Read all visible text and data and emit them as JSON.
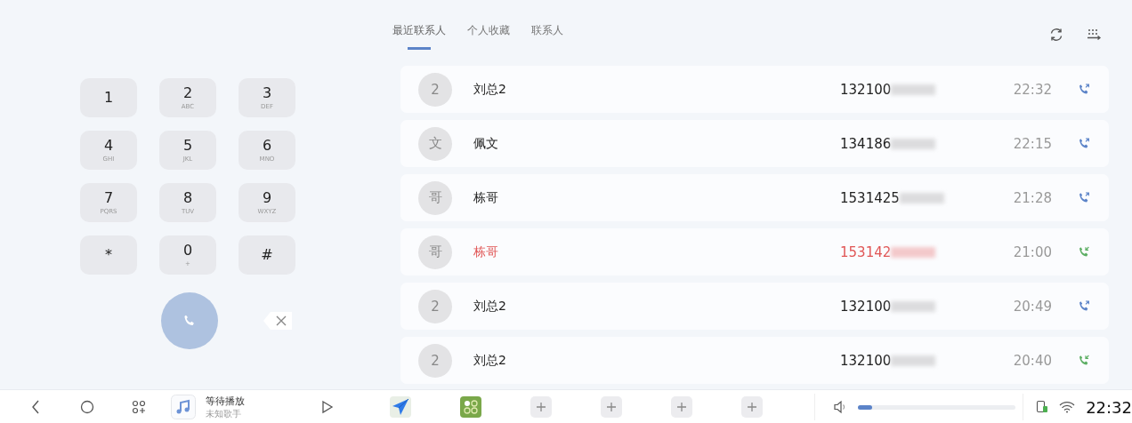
{
  "dialpad": {
    "keys": [
      {
        "digit": "1"
      },
      {
        "digit": "2",
        "letters": "ABC"
      },
      {
        "digit": "3",
        "letters": "DEF"
      },
      {
        "digit": "4",
        "letters": "GHI"
      },
      {
        "digit": "5",
        "letters": "JKL"
      },
      {
        "digit": "6",
        "letters": "MNO"
      },
      {
        "digit": "7",
        "letters": "PQRS"
      },
      {
        "digit": "8",
        "letters": "TUV"
      },
      {
        "digit": "9",
        "letters": "WXYZ"
      },
      {
        "digit": "*"
      },
      {
        "digit": "0",
        "letters": "+"
      },
      {
        "digit": "#"
      }
    ]
  },
  "tabs": [
    {
      "label": "最近联系人",
      "selected": true
    },
    {
      "label": "个人收藏",
      "selected": false
    },
    {
      "label": "联系人",
      "selected": false
    }
  ],
  "calls": [
    {
      "avatar": "2",
      "name": "刘总2",
      "number": "132100",
      "time": "22:32",
      "kind": "outgoing",
      "missed": false
    },
    {
      "avatar": "文",
      "name": "佩文",
      "number": "134186",
      "time": "22:15",
      "kind": "outgoing",
      "missed": false
    },
    {
      "avatar": "哥",
      "name": "栋哥",
      "number": "1531425",
      "time": "21:28",
      "kind": "outgoing",
      "missed": false
    },
    {
      "avatar": "哥",
      "name": "栋哥",
      "number": "153142",
      "time": "21:00",
      "kind": "incoming",
      "missed": true
    },
    {
      "avatar": "2",
      "name": "刘总2",
      "number": "132100",
      "time": "20:49",
      "kind": "outgoing",
      "missed": false
    },
    {
      "avatar": "2",
      "name": "刘总2",
      "number": "132100",
      "time": "20:40",
      "kind": "incoming",
      "missed": false
    }
  ],
  "taskbar": {
    "media": {
      "title": "等待播放",
      "artist": "未知歌手"
    },
    "dock": [
      {
        "kind": "navigation"
      },
      {
        "kind": "apps"
      },
      {
        "kind": "add"
      },
      {
        "kind": "add"
      },
      {
        "kind": "add"
      },
      {
        "kind": "add"
      }
    ],
    "volume": {
      "level": 0.09
    },
    "clock": "22:32"
  }
}
